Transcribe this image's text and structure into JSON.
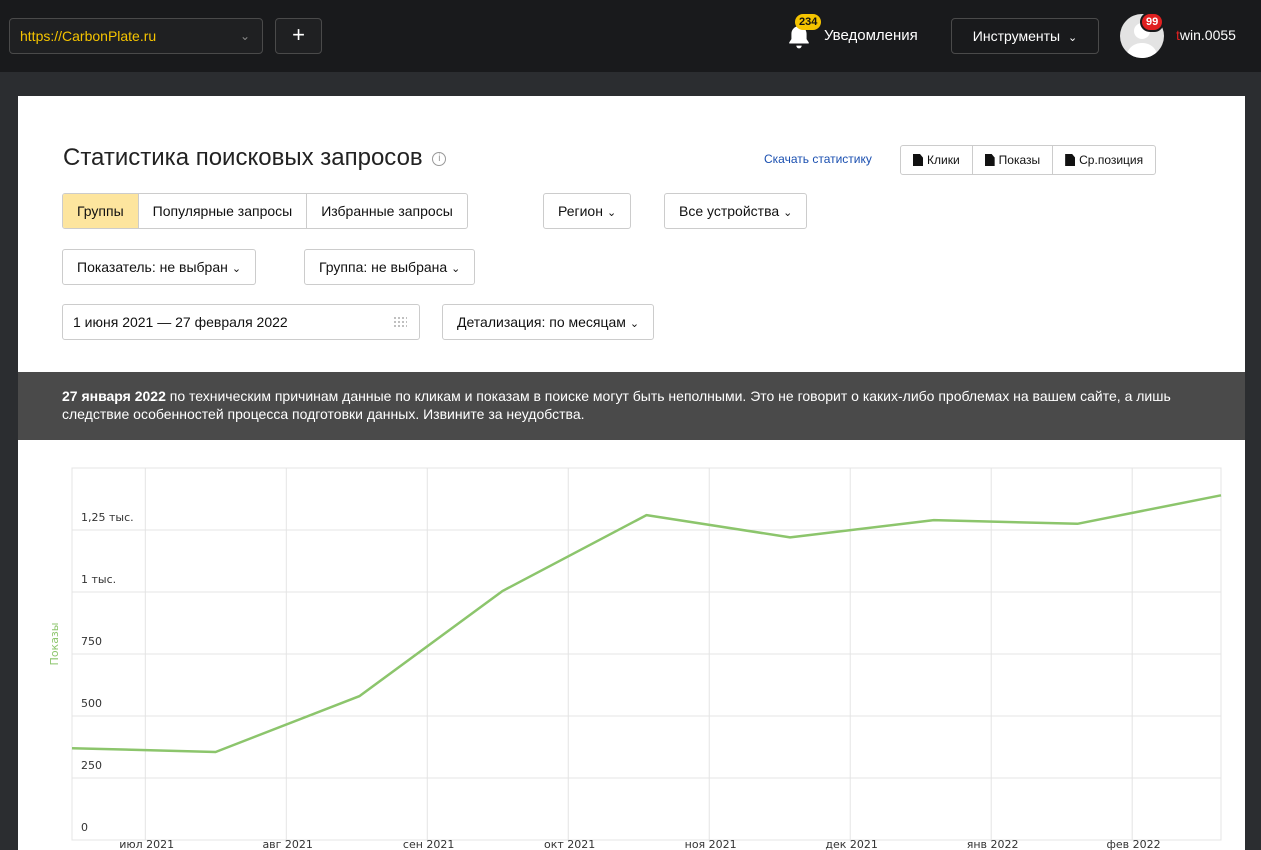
{
  "topbar": {
    "site_url": "https://CarbonPlate.ru",
    "add_label": "+",
    "notifications_count": "234",
    "notifications_label": "Уведомления",
    "tools_label": "Инструменты",
    "avatar_badge": "99",
    "username_first": "t",
    "username_rest": "win.0055"
  },
  "page": {
    "title": "Статистика поисковых запросов",
    "info": "i",
    "download_label": "Скачать статистику",
    "download_buttons": [
      "Клики",
      "Показы",
      "Ср.позиция"
    ],
    "tabs": [
      "Группы",
      "Популярные запросы",
      "Избранные запросы"
    ],
    "region_label": "Регион",
    "devices_label": "Все устройства",
    "metric_label": "Показатель: не выбран",
    "group_label": "Группа: не выбрана",
    "date_range": "1 июня 2021 — 27 февраля 2022",
    "detail_label": "Детализация: по месяцам"
  },
  "notice": {
    "bold": "27 января 2022",
    "text": " по техническим причинам данные по кликам и показам в поиске могут быть неполными. Это не говорит о каких-либо проблемах на вашем сайте, а лишь следствие особенностей процесса подготовки данных. Извините за неудобства."
  },
  "colors": {
    "accent": "#f5c400",
    "line": "#8cc56c",
    "tab_active": "#fde59e",
    "badge_red": "#e02020"
  },
  "chart_data": {
    "type": "line",
    "ylabel": "Показы",
    "ylim": [
      0,
      1500
    ],
    "yticks": [
      {
        "value": 0,
        "label": "0"
      },
      {
        "value": 250,
        "label": "250"
      },
      {
        "value": 500,
        "label": "500"
      },
      {
        "value": 750,
        "label": "750"
      },
      {
        "value": 1000,
        "label": "1 тыс."
      },
      {
        "value": 1250,
        "label": "1,25 тыс."
      }
    ],
    "xticks": [
      "июл 2021",
      "авг 2021",
      "сен 2021",
      "окт 2021",
      "ноя 2021",
      "дек 2021",
      "янв 2022",
      "фев 2022"
    ],
    "grid": true,
    "series": [
      {
        "values": [
          370,
          355,
          580,
          1005,
          1310,
          1220,
          1290,
          1275,
          1390
        ]
      }
    ]
  }
}
